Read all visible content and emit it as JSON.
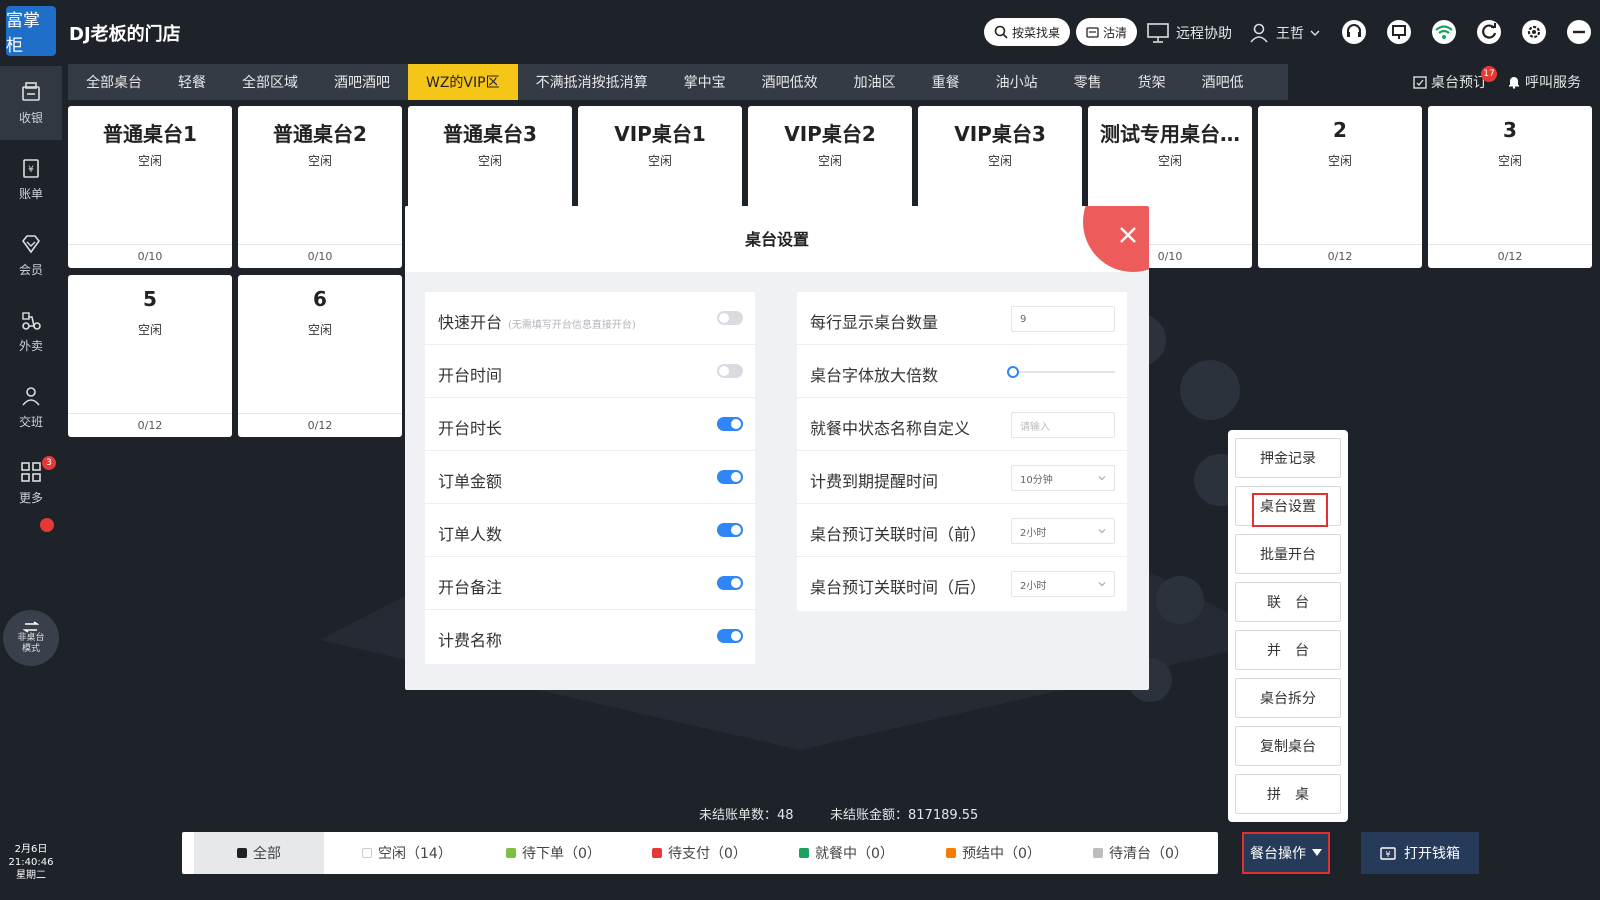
{
  "app": {
    "logo_text": "富掌柜",
    "store_name": "DJ老板的门店"
  },
  "header": {
    "search_dish": "按菜找桌",
    "clear": "沽清",
    "remote_help": "远程协助",
    "user_name": "王哲"
  },
  "sidebar": {
    "items": [
      {
        "label": "收银",
        "icon": "cashier-icon"
      },
      {
        "label": "账单",
        "icon": "bill-icon"
      },
      {
        "label": "会员",
        "icon": "member-icon"
      },
      {
        "label": "外卖",
        "icon": "takeout-icon"
      },
      {
        "label": "交班",
        "icon": "shift-icon"
      },
      {
        "label": "更多",
        "icon": "more-icon",
        "badge": "3"
      }
    ],
    "mode_line1": "非桌台",
    "mode_line2": "模式",
    "date": "2月6日",
    "time": "21:40:46",
    "weekday": "星期二"
  },
  "tabs": [
    "全部桌台",
    "轻餐",
    "全部区域",
    "酒吧酒吧",
    "WZ的VIP区",
    "不满抵消按抵消算",
    "掌中宝",
    "酒吧低效",
    "加油区",
    "重餐",
    "油小站",
    "零售",
    "货架",
    "酒吧低"
  ],
  "tabs_right": {
    "reserve": "桌台预订",
    "reserve_badge": "17",
    "call": "呼叫服务"
  },
  "tables": [
    {
      "name": "普通桌台1",
      "status": "空闲",
      "count": "0/10"
    },
    {
      "name": "普通桌台2",
      "status": "空闲",
      "count": "0/10"
    },
    {
      "name": "普通桌台3",
      "status": "空闲",
      "count": ""
    },
    {
      "name": "VIP桌台1",
      "status": "空闲",
      "count": ""
    },
    {
      "name": "VIP桌台2",
      "status": "空闲",
      "count": ""
    },
    {
      "name": "VIP桌台3",
      "status": "空闲",
      "count": ""
    },
    {
      "name": "测试专用桌台…",
      "status": "空闲",
      "count": "0/10"
    },
    {
      "name": "2",
      "status": "空闲",
      "count": "0/12"
    },
    {
      "name": "3",
      "status": "空闲",
      "count": "0/12"
    },
    {
      "name": "5",
      "status": "空闲",
      "count": "0/12"
    },
    {
      "name": "6",
      "status": "空闲",
      "count": "0/12"
    }
  ],
  "modal": {
    "title": "桌台设置",
    "left_rows": [
      {
        "label": "快速开台",
        "hint": "(无需填写开台信息直接开台)",
        "on": false
      },
      {
        "label": "开台时间",
        "hint": "",
        "on": false
      },
      {
        "label": "开台时长",
        "hint": "",
        "on": true
      },
      {
        "label": "订单金额",
        "hint": "",
        "on": true
      },
      {
        "label": "订单人数",
        "hint": "",
        "on": true
      },
      {
        "label": "开台备注",
        "hint": "",
        "on": true
      },
      {
        "label": "计费名称",
        "hint": "",
        "on": true
      }
    ],
    "right_rows": [
      {
        "label": "每行显示桌台数量",
        "kind": "input",
        "value": "9"
      },
      {
        "label": "桌台字体放大倍数",
        "kind": "slider",
        "value": 0
      },
      {
        "label": "就餐中状态名称自定义",
        "kind": "input",
        "placeholder": "请输入"
      },
      {
        "label": "计费到期提醒时间",
        "kind": "select",
        "value": "10分钟"
      },
      {
        "label": "桌台预订关联时间（前）",
        "kind": "select",
        "value": "2小时"
      },
      {
        "label": "桌台预订关联时间（后）",
        "kind": "select",
        "value": "2小时"
      }
    ]
  },
  "popmenu": [
    "押金记录",
    "桌台设置",
    "批量开台",
    "联　台",
    "并　台",
    "桌台拆分",
    "复制桌台",
    "拼　桌"
  ],
  "stats": {
    "unsettled_count": "未结账单数：48",
    "unsettled_amount": "未结账金额：817189.55"
  },
  "filters": [
    {
      "label": "全部",
      "color": "#222222"
    },
    {
      "label": "空闲（14）",
      "color": "#ffffff"
    },
    {
      "label": "待下单（0）",
      "color": "#7bc043"
    },
    {
      "label": "待支付（0）",
      "color": "#e53935"
    },
    {
      "label": "就餐中（0）",
      "color": "#1aa260"
    },
    {
      "label": "预结中（0）",
      "color": "#f57c00"
    },
    {
      "label": "待清台（0）",
      "color": "#bdbdbd"
    }
  ],
  "ops_button": "餐台操作",
  "drawer_button": "打开钱箱"
}
